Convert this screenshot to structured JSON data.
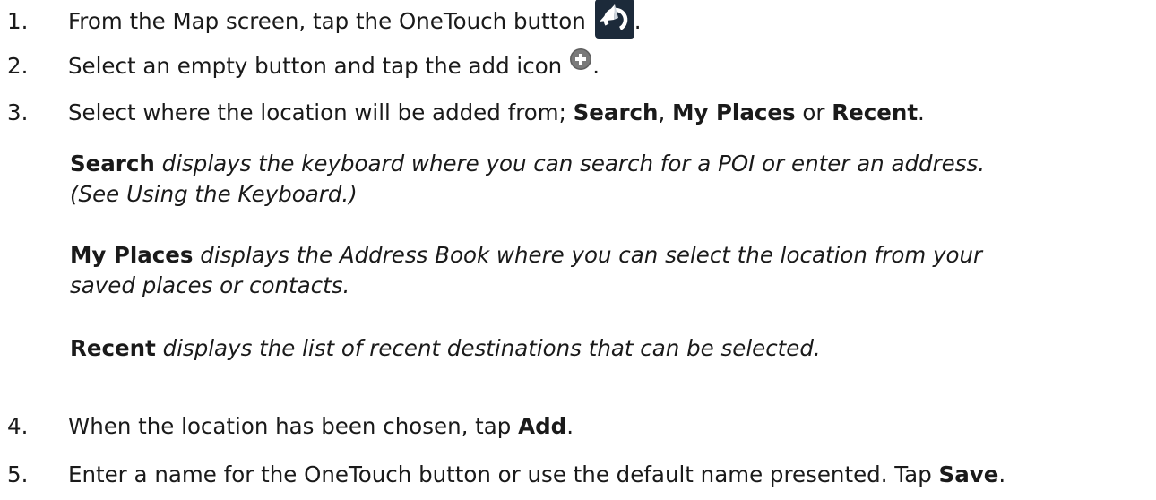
{
  "steps": [
    {
      "num": "1.",
      "text_before": "From the Map screen, tap the OneTouch button",
      "text_after": "."
    },
    {
      "num": "2.",
      "text_before": "Select an empty button and tap the add icon",
      "text_after": "."
    },
    {
      "num": "3.",
      "text_before": "Select where the location will be added from;",
      "bold1": "Search",
      "sep1": ",",
      "bold2": "My Places",
      "sep2": "or",
      "bold3": "Recent",
      "text_after": "."
    },
    {
      "num": "4.",
      "text_before": "When the location has been chosen, tap",
      "bold1": "Add",
      "text_after": "."
    },
    {
      "num": "5.",
      "text_before": "Enter a name for the OneTouch button or use the default name presented. Tap",
      "bold1": "Save",
      "text_after": "."
    }
  ],
  "options": [
    {
      "term": "Search",
      "desc": "displays the keyboard where you can search for a POI or enter an address.",
      "desc2_before": "(See",
      "desc2_italic": "Using the Keyboard",
      "desc2_after": ".)"
    },
    {
      "term": "My Places",
      "desc": "displays the Address Book where you can select the location from your",
      "desc2": "saved places or contacts."
    },
    {
      "term": "Recent",
      "desc": "displays the list of recent destinations that can be selected."
    }
  ],
  "icons": {
    "onetouch": "onetouch-icon",
    "add": "add-icon"
  },
  "colors": {
    "text": "#1a1a1a",
    "onetouch_bg": "#1c2a3a",
    "add_icon": "#6e6e6e"
  }
}
